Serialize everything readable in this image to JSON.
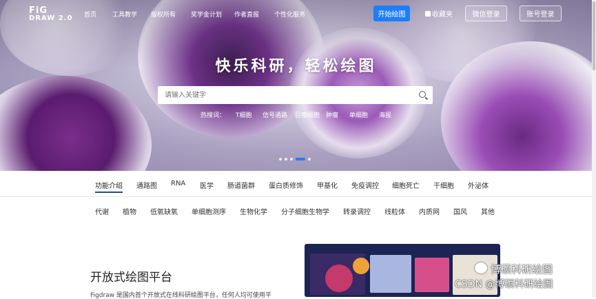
{
  "logo": {
    "line1": "FiG",
    "line2": "DRAW 2.0"
  },
  "nav": {
    "items": [
      "首页",
      "工具教学",
      "版权所有",
      "奖学金计划",
      "作者直报",
      "个性化服务"
    ],
    "start_button": "开始绘图",
    "favorites": "收藏夹",
    "wechat_login": "微信登录",
    "account_login": "账号登录"
  },
  "hero": {
    "title": "快乐科研，轻松绘图",
    "search_placeholder": "请输入关键字",
    "hot_label": "热搜词：",
    "hot_words": [
      "T细胞",
      "信号通路",
      "巨噬细胞",
      "肿瘤",
      "单细胞",
      "海报"
    ],
    "carousel_active_index": 3
  },
  "categories_row1": [
    "功能介绍",
    "通路图",
    "RNA",
    "医学",
    "肠道菌群",
    "蛋白质修饰",
    "甲基化",
    "免疫调控",
    "细胞死亡",
    "干细胞",
    "外泌体"
  ],
  "categories_row2": [
    "代谢",
    "植物",
    "低氧缺氧",
    "单细胞测序",
    "生物化学",
    "分子细胞生物学",
    "转录调控",
    "线粒体",
    "内质网",
    "国风",
    "其他"
  ],
  "section": {
    "title": "开放式绘图平台",
    "desc": "Figdraw 是国内首个开放式在线科研绘图平台，任何人均可使用平"
  },
  "watermark": {
    "line1": "博硕科研绘图",
    "line2": "CSDN @博硕科研绘图"
  },
  "colors": {
    "accent": "#1f7ef5",
    "tab_underline": "#1f4e7a"
  }
}
